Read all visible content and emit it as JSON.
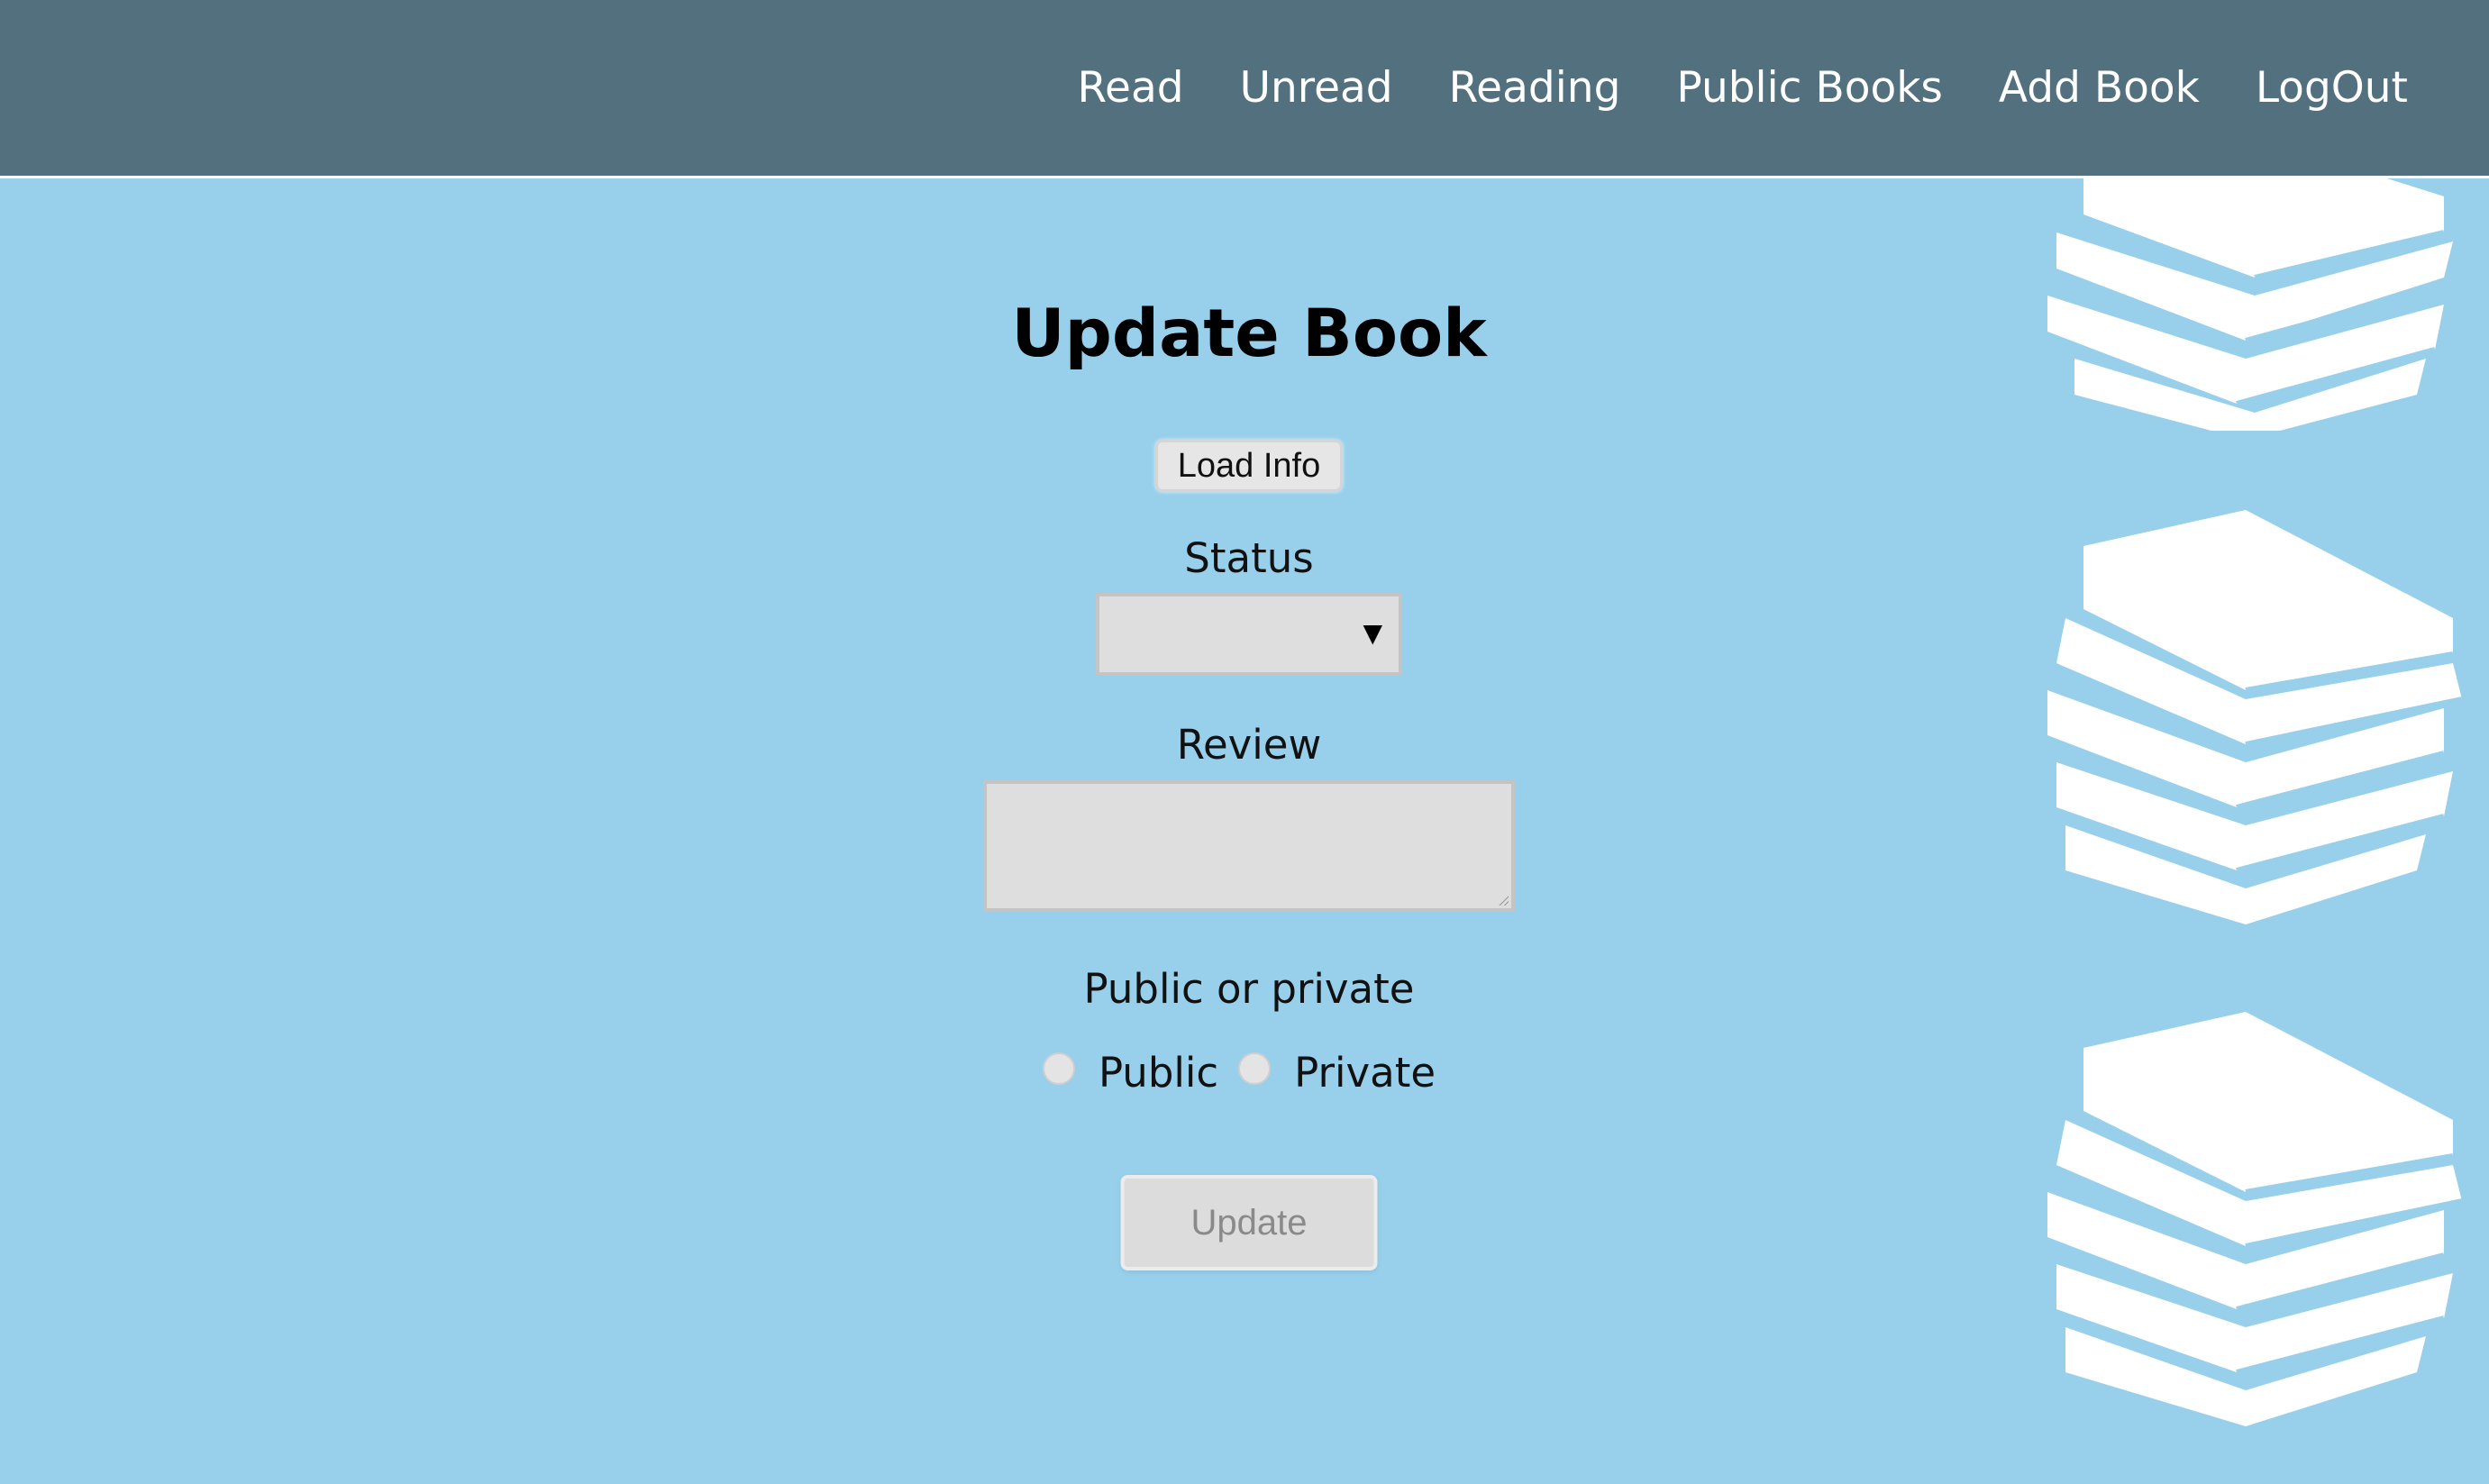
{
  "nav": {
    "items": [
      {
        "label": "Read"
      },
      {
        "label": "Unread"
      },
      {
        "label": "Reading"
      },
      {
        "label": "Public Books"
      },
      {
        "label": "Add Book"
      },
      {
        "label": "LogOut"
      }
    ]
  },
  "form": {
    "title": "Update Book",
    "load_button": "Load Info",
    "status_label": "Status",
    "status_value": "",
    "review_label": "Review",
    "review_value": "",
    "visibility_label": "Public or private",
    "visibility_options": [
      "Public",
      "Private"
    ],
    "update_button": "Update"
  },
  "colors": {
    "navbar": "#53707f",
    "background": "#98d0eb",
    "decoration": "#ffffff"
  },
  "icons": {
    "decoration": "book-stack-icon"
  }
}
